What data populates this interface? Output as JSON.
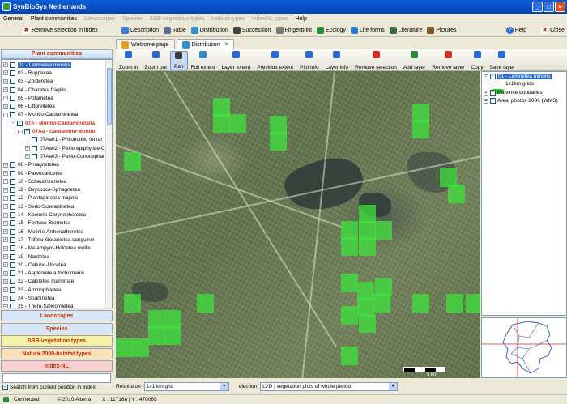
{
  "window": {
    "title": "SynBioSys Netherlands"
  },
  "menu": [
    "General",
    "Plant communities",
    "Landscapes",
    "Species",
    "SBB-vegetation types",
    "Habitat types",
    "IndexNL types",
    "Help"
  ],
  "menu_disabled": [
    false,
    false,
    true,
    true,
    true,
    true,
    true,
    false
  ],
  "toolbar": {
    "items": [
      {
        "label": "Description",
        "icon": "description-icon",
        "color": "#3b7bd6"
      },
      {
        "label": "Table",
        "icon": "table-icon",
        "color": "#5a6f8e"
      },
      {
        "label": "Distribution",
        "icon": "globe-icon",
        "color": "#2f8fd0"
      },
      {
        "label": "Succession",
        "icon": "succession-icon",
        "color": "#444444"
      },
      {
        "label": "Fingerprint",
        "icon": "fingerprint-icon",
        "color": "#777777"
      },
      {
        "label": "Ecology",
        "icon": "ecology-icon",
        "color": "#2a8a3a"
      },
      {
        "label": "Life forms",
        "icon": "lifeforms-icon",
        "color": "#2a7bd0"
      },
      {
        "label": "Literature",
        "icon": "literature-icon",
        "color": "#3a6a3a"
      },
      {
        "label": "Pictures",
        "icon": "pictures-icon",
        "color": "#7a5a2a"
      }
    ],
    "help": "Help",
    "close": "Close"
  },
  "left": {
    "remove_selection": "Remove selection in index",
    "header": "Plant communities",
    "tree": [
      {
        "label": "01 - Lemnetea minoris",
        "level": 0,
        "exp": "+",
        "checked": false,
        "sel": true,
        "red": false
      },
      {
        "label": "02 - Ruppietea",
        "level": 0,
        "exp": "+",
        "checked": false,
        "sel": false,
        "red": false
      },
      {
        "label": "03 - Zosteretea",
        "level": 0,
        "exp": "+",
        "checked": false,
        "sel": false,
        "red": false
      },
      {
        "label": "04 - Charetea fragilis",
        "level": 0,
        "exp": "+",
        "checked": false,
        "sel": false,
        "red": false
      },
      {
        "label": "05 - Potametea",
        "level": 0,
        "exp": "+",
        "checked": false,
        "sel": false,
        "red": false
      },
      {
        "label": "06 - Littorelletea",
        "level": 0,
        "exp": "+",
        "checked": false,
        "sel": false,
        "red": false
      },
      {
        "label": "07 - Montio-Cardaminetea",
        "level": 0,
        "exp": "−",
        "checked": false,
        "sel": false,
        "red": false
      },
      {
        "label": "07A - Montio-Cardaminetalia",
        "level": 1,
        "exp": "−",
        "checked": true,
        "sel": false,
        "red": true
      },
      {
        "label": "07Aa - Cardamino-Montio",
        "level": 2,
        "exp": "−",
        "checked": true,
        "sel": false,
        "red": true
      },
      {
        "label": "07Aa01 - Philonotido fontar",
        "level": 3,
        "exp": "",
        "checked": false,
        "sel": false,
        "red": false
      },
      {
        "label": "07Aa02 - Pellio epiphyllae-C",
        "level": 3,
        "exp": "+",
        "checked": false,
        "sel": false,
        "red": false
      },
      {
        "label": "07Aa03 - Pellio-Conocephal",
        "level": 3,
        "exp": "+",
        "checked": false,
        "sel": false,
        "red": false
      },
      {
        "label": "08 - Phragmitetea",
        "level": 0,
        "exp": "+",
        "checked": false,
        "sel": false,
        "red": false
      },
      {
        "label": "09 - Parvocaricetea",
        "level": 0,
        "exp": "+",
        "checked": false,
        "sel": false,
        "red": false
      },
      {
        "label": "10 - Scheuchzerietea",
        "level": 0,
        "exp": "+",
        "checked": false,
        "sel": false,
        "red": false
      },
      {
        "label": "11 - Oxycocco-Sphagnetea",
        "level": 0,
        "exp": "+",
        "checked": false,
        "sel": false,
        "red": false
      },
      {
        "label": "12 - Plantaginetea majoris",
        "level": 0,
        "exp": "+",
        "checked": false,
        "sel": false,
        "red": false
      },
      {
        "label": "13 - Sedo-Scleranthetea",
        "level": 0,
        "exp": "+",
        "checked": false,
        "sel": false,
        "red": false
      },
      {
        "label": "14 - Koelerio-Corynephoretea",
        "level": 0,
        "exp": "+",
        "checked": false,
        "sel": false,
        "red": false
      },
      {
        "label": "15 - Festuco-Brometea",
        "level": 0,
        "exp": "+",
        "checked": false,
        "sel": false,
        "red": false
      },
      {
        "label": "16 - Molinio-Arrhenatheretea",
        "level": 0,
        "exp": "+",
        "checked": false,
        "sel": false,
        "red": false
      },
      {
        "label": "17 - Trifolio-Geranietea sanguinei",
        "level": 0,
        "exp": "+",
        "checked": false,
        "sel": false,
        "red": false
      },
      {
        "label": "18 - Melampyro-Holcetea mollis",
        "level": 0,
        "exp": "+",
        "checked": false,
        "sel": false,
        "red": false
      },
      {
        "label": "19 - Nardetea",
        "level": 0,
        "exp": "+",
        "checked": false,
        "sel": false,
        "red": false
      },
      {
        "label": "20 - Calluno-Ulicetea",
        "level": 0,
        "exp": "+",
        "checked": false,
        "sel": false,
        "red": false
      },
      {
        "label": "21 - Aspleniete a trichomanis",
        "level": 0,
        "exp": "+",
        "checked": false,
        "sel": false,
        "red": false
      },
      {
        "label": "22 - Cakiletea maritimae",
        "level": 0,
        "exp": "+",
        "checked": false,
        "sel": false,
        "red": false
      },
      {
        "label": "23 - Ammophiletea",
        "level": 0,
        "exp": "+",
        "checked": false,
        "sel": false,
        "red": false
      },
      {
        "label": "24 - Spartinetea",
        "level": 0,
        "exp": "+",
        "checked": false,
        "sel": false,
        "red": false
      },
      {
        "label": "25 - Thero-Salicornietea",
        "level": 0,
        "exp": "+",
        "checked": false,
        "sel": false,
        "red": false
      }
    ],
    "categories": [
      {
        "label": "Landscapes",
        "bg": "#d6e6f6",
        "color": "#c03000"
      },
      {
        "label": "Species",
        "bg": "#d6e6f6",
        "color": "#c03000"
      },
      {
        "label": "SBB-vegetation types",
        "bg": "#f4f0a8",
        "color": "#c03000"
      },
      {
        "label": "Natura 2000-habitat types",
        "bg": "#fbe1b8",
        "color": "#c03000"
      },
      {
        "label": "Index-NL",
        "bg": "#f6d0d0",
        "color": "#c03000"
      }
    ],
    "search_current": "Search from current position in index"
  },
  "tabs": [
    {
      "label": "Welcome page",
      "active": false,
      "closable": false
    },
    {
      "label": "Distribution",
      "active": true,
      "closable": true
    }
  ],
  "map_tools": [
    {
      "label": "Zoom in",
      "icon": "zoom-in-icon",
      "color": "#2a6ad0",
      "active": false
    },
    {
      "label": "Zoom out",
      "icon": "zoom-out-icon",
      "color": "#2a6ad0",
      "active": false
    },
    {
      "label": "Pan",
      "icon": "pan-icon",
      "color": "#3a3a3a",
      "active": true
    },
    {
      "label": "Full extent",
      "icon": "full-extent-icon",
      "color": "#2a8ad0",
      "active": false
    },
    {
      "label": "Layer extent",
      "icon": "layer-extent-icon",
      "color": "#2a6ad0",
      "active": false
    },
    {
      "label": "Previous extent",
      "icon": "previous-extent-icon",
      "color": "#2a6ad0",
      "active": false
    },
    {
      "label": "Plot info",
      "icon": "plot-info-icon",
      "color": "#2a6ad0",
      "active": false
    },
    {
      "label": "Layer info",
      "icon": "layer-info-icon",
      "color": "#2a6ad0",
      "active": false
    },
    {
      "label": "Remove selection",
      "icon": "remove-selection-icon",
      "color": "#d03020",
      "active": false
    },
    {
      "label": "Add layer",
      "icon": "add-layer-icon",
      "color": "#2a8a3a",
      "active": false
    },
    {
      "label": "Remove layer",
      "icon": "remove-layer-icon",
      "color": "#d03020",
      "active": false
    },
    {
      "label": "Copy",
      "icon": "copy-icon",
      "color": "#2a6ad0",
      "active": false
    },
    {
      "label": "Save layer",
      "icon": "save-layer-icon",
      "color": "#2a6ad0",
      "active": false
    }
  ],
  "layers": [
    {
      "label": "01 - Lemnetea minoris",
      "sel": true
    },
    {
      "label": "1x1km grids",
      "legend": true
    },
    {
      "label": "Province boudaries",
      "sel": false
    },
    {
      "label": "Areal photos 2006 (WMS)",
      "sel": false
    }
  ],
  "grid_color": "#3ce63c",
  "map_scale_label": "5 km",
  "bottom": {
    "resolution_label": "Resolution",
    "resolution_value": "1x1 km grid",
    "selection_label": "election",
    "selection_value": "LVD | vegetation plots of whole period"
  },
  "status": {
    "connection": "Connected",
    "copyright": "© 2010 Alterra",
    "coords": "X : 117188 | Y : 470069"
  }
}
